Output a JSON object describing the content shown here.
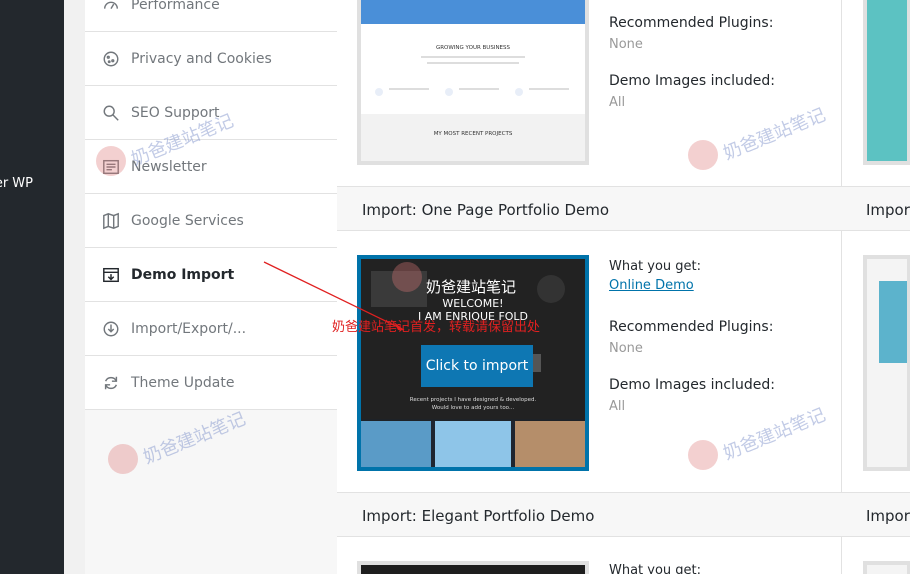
{
  "wp_menu": {
    "partial_item": "er WP"
  },
  "options_menu": [
    {
      "label": "Performance",
      "icon": "gauge-icon"
    },
    {
      "label": "Privacy and Cookies",
      "icon": "cookie-icon"
    },
    {
      "label": "SEO Support",
      "icon": "search-icon"
    },
    {
      "label": "Newsletter",
      "icon": "newsletter-icon"
    },
    {
      "label": "Google Services",
      "icon": "map-icon"
    },
    {
      "label": "Demo Import",
      "icon": "import-icon",
      "active": true
    },
    {
      "label": "Import/Export/...",
      "icon": "import-export-icon"
    },
    {
      "label": "Theme Update",
      "icon": "refresh-icon"
    }
  ],
  "demos": {
    "top_card": {
      "recommended_label": "Recommended Plugins:",
      "recommended_value": "None",
      "images_label": "Demo Images included:",
      "images_value": "All",
      "thumb_texts": [
        "GROWING YOUR BUSINESS",
        "MY MOST RECENT PROJECTS"
      ]
    },
    "one_page": {
      "title": "Import: One Page Portfolio Demo",
      "side_title": "Import",
      "what_label": "What you get:",
      "online_demo": "Online Demo",
      "recommended_label": "Recommended Plugins:",
      "recommended_value": "None",
      "images_label": "Demo Images included:",
      "images_value": "All",
      "thumb_heading": "WELCOME!\nI AM ENRIQUE FOLD",
      "thumb_sub": "Recent projects I have designed & developed.\nWould love to add yours too...",
      "import_button": "Click to import"
    },
    "elegant": {
      "title": "Import: Elegant Portfolio Demo",
      "side_title": "Import",
      "what_label": "What you get:"
    }
  },
  "watermarks": {
    "text": "奶爸建站笔记",
    "annotation": "奶爸建站笔记首发，转载请保留出处"
  },
  "colors": {
    "accent": "#0073aa",
    "button": "#0e77b3",
    "admin_bar": "#23282d",
    "annotation": "#e02020"
  }
}
